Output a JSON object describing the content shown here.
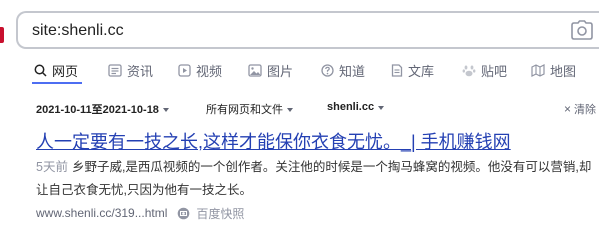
{
  "search": {
    "query": "site:shenli.cc"
  },
  "tabs": [
    {
      "label": "网页",
      "icon": "search-icon",
      "active": true
    },
    {
      "label": "资讯",
      "icon": "news-icon"
    },
    {
      "label": "视频",
      "icon": "video-icon"
    },
    {
      "label": "图片",
      "icon": "image-icon"
    },
    {
      "label": "知道",
      "icon": "question-icon"
    },
    {
      "label": "文库",
      "icon": "document-icon"
    },
    {
      "label": "贴吧",
      "icon": "tieba-icon"
    },
    {
      "label": "地图",
      "icon": "map-icon"
    }
  ],
  "filters": {
    "date_range": "2021-10-11至2021-10-18",
    "file_type": "所有网页和文件",
    "site": "shenli.cc",
    "clear_label": "清除"
  },
  "result": {
    "title": "人一定要有一技之长,这样才能保你衣食无忧。_| 手机赚钱网",
    "age": "5天前",
    "snippet": "乡野子威,是西瓜视频的一个创作者。关注他的时候是一个掏马蜂窝的视频。他没有可以营销,却让自己衣食无忧,只因为他有一技之长。",
    "url": "www.shenli.cc/319...html",
    "snapshot_label": "百度快照"
  },
  "colors": {
    "accent": "#4e6ef2",
    "link": "#2440b3",
    "brand": "#c8102e"
  }
}
